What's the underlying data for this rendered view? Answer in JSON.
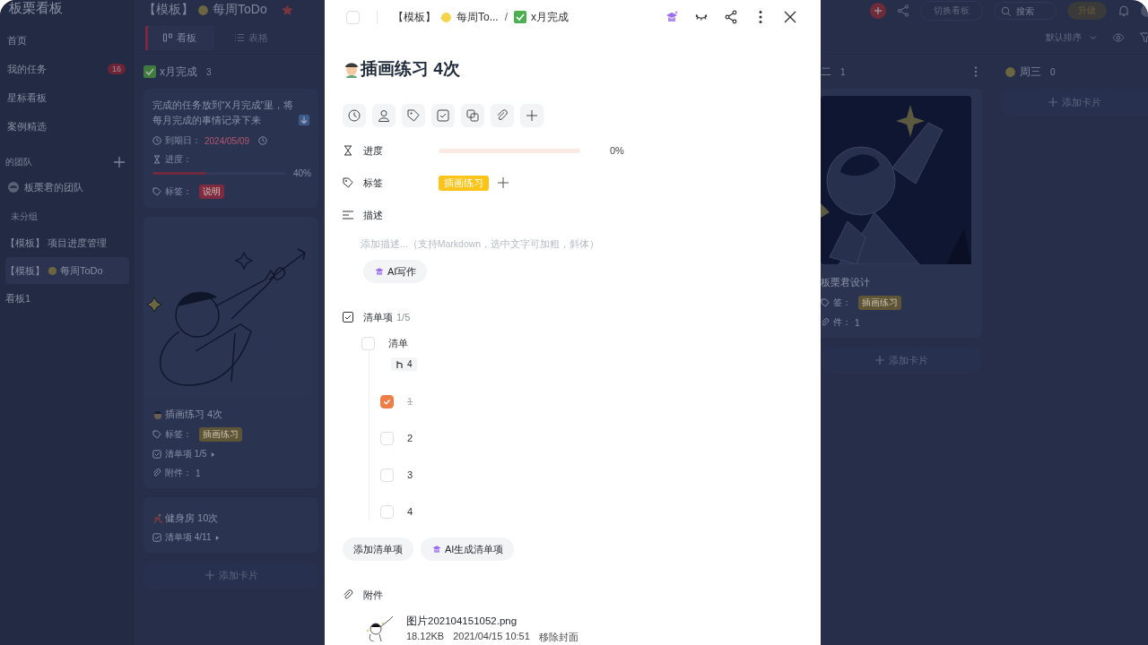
{
  "sidebar": {
    "title": "板栗看板",
    "nav": [
      {
        "label": "首页",
        "selected": false
      },
      {
        "label": "我的任务",
        "badge": "16",
        "selected": false
      },
      {
        "label": "星标看板",
        "selected": false
      },
      {
        "label": "案例精选",
        "selected": false
      }
    ],
    "team_heading": "的团队",
    "team": "板栗君的团队",
    "group_heading": "未分组",
    "boards": [
      {
        "prefix": "【模板】",
        "name": "项目进度管理",
        "emoji": false,
        "selected": false
      },
      {
        "prefix": "【模板】",
        "name": "每周ToDo",
        "emoji": true,
        "selected": true
      },
      {
        "name": "看板1",
        "emoji": false,
        "selected": false
      }
    ]
  },
  "topbar": {
    "board_prefix": "【模板】",
    "board_name": "每周ToDo",
    "starred": true,
    "switch_button": "切换看板",
    "search": {
      "placeholder": "搜索"
    },
    "upgrade_button": "升级"
  },
  "views": {
    "tabs": [
      {
        "label": "看板",
        "selected": true
      },
      {
        "label": "表格",
        "selected": false
      }
    ],
    "sort": "默认排序"
  },
  "columns": [
    {
      "title": "x月完成",
      "count": "3",
      "add": "添加卡片",
      "cards": [
        {
          "kind": "note",
          "text": "完成的任务放到“X月完成”里，将每月完成的事情记录下来",
          "due_label": "到期日：",
          "due": "2024/05/09",
          "progress_label": "进度：",
          "level": 0.4,
          "percent": "40%",
          "tag_label": "标签：",
          "tags": [
            {
              "label": "说明",
              "color": "#7e2a40"
            }
          ]
        },
        {
          "kind": "illustrated",
          "title": "插画练习 4次",
          "tag_label": "标签：",
          "tags": [
            {
              "label": "插画练习",
              "color": "#5e5436"
            }
          ],
          "checklist": "清单项 1/5",
          "attach_label": "附件：",
          "attachments": "1"
        },
        {
          "kind": "plain",
          "title": "健身房 10次",
          "checklist": "清单项 4/11"
        }
      ]
    },
    {
      "title": "二",
      "count": "1",
      "add": "添加卡片",
      "cards": [
        {
          "kind": "cover",
          "title": "板栗君设计",
          "tag_label": "签：",
          "tags": [
            {
              "label": "插画练习",
              "color": "#5e5436"
            }
          ],
          "attach_label": "件：",
          "attachments": "1"
        }
      ]
    },
    {
      "title": "周三",
      "count": "0",
      "add": "添加卡片"
    }
  ],
  "detail": {
    "done": false,
    "breadcrumb": {
      "board_prefix": "【模板】",
      "board_name": "每周To...",
      "separator": "/",
      "column": "x月完成"
    },
    "title": "插画练习 4次",
    "progress": {
      "label": "进度",
      "level": 0,
      "percent": "0%"
    },
    "tags": {
      "label": "标签",
      "items": [
        {
          "label": "插画练习",
          "color": "#fcc419"
        }
      ]
    },
    "description": {
      "label": "描述",
      "placeholder": "添加描述...（支持Markdown，选中文字可加粗，斜体）",
      "ai_button": "AI写作"
    },
    "checklist": {
      "label": "清单项",
      "count": "1/5",
      "items": [
        {
          "label": "清单",
          "checked": false,
          "subcount": "4",
          "children": [
            {
              "label": "1",
              "checked": true
            },
            {
              "label": "2",
              "checked": false
            },
            {
              "label": "3",
              "checked": false
            },
            {
              "label": "4",
              "checked": false
            }
          ]
        }
      ],
      "add_button": "添加清单项",
      "ai_button": "AI生成清单项"
    },
    "attachments": {
      "label": "附件",
      "files": [
        {
          "name": "图片202104151052.png",
          "size": "18.12KB",
          "time": "2021/04/15 10:51",
          "action": "移除封面"
        }
      ]
    }
  }
}
